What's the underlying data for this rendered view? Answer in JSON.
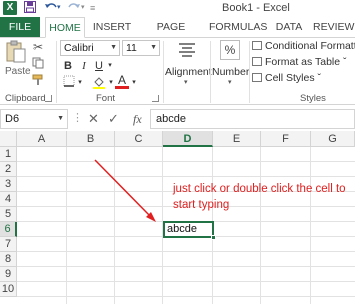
{
  "window": {
    "title": "Book1 - Excel"
  },
  "quick_access": {
    "app_icon": "X",
    "save_icon": "floppy-disk",
    "undo_icon": "undo-arrow",
    "redo_icon": "redo-arrow"
  },
  "ribbon_tabs": [
    {
      "label": "FILE"
    },
    {
      "label": "HOME"
    },
    {
      "label": "INSERT"
    },
    {
      "label": "PAGE LAYOUT"
    },
    {
      "label": "FORMULAS"
    },
    {
      "label": "DATA"
    },
    {
      "label": "REVIEW"
    }
  ],
  "clipboard": {
    "paste_label": "Paste",
    "group_label": "Clipboard"
  },
  "font": {
    "family": "Calibri",
    "size": "11",
    "bold": "B",
    "italic": "I",
    "underline": "U",
    "font_color_letter": "A",
    "group_label": "Font"
  },
  "alignment": {
    "label": "Alignment"
  },
  "number": {
    "label": "Number",
    "symbol": "%"
  },
  "styles": {
    "conditional_formatting": "Conditional Formattin",
    "format_as_table": "Format as Table ˇ",
    "cell_styles": "Cell Styles ˇ",
    "group_label": "Styles"
  },
  "formula_bar": {
    "name_box": "D6",
    "fx": "fx",
    "value": "abcde"
  },
  "grid": {
    "columns": [
      "A",
      "B",
      "C",
      "D",
      "E",
      "F",
      "G"
    ],
    "rows": [
      "1",
      "2",
      "3",
      "4",
      "5",
      "6",
      "7",
      "8",
      "9",
      "10"
    ],
    "active_cell": "D6",
    "active_cell_value": "abcde"
  },
  "annotation": {
    "text": "just click or double click the cell to start typing",
    "color": "#e02020"
  },
  "colors": {
    "excel_green": "#217346",
    "annotation_red": "#e02020"
  }
}
